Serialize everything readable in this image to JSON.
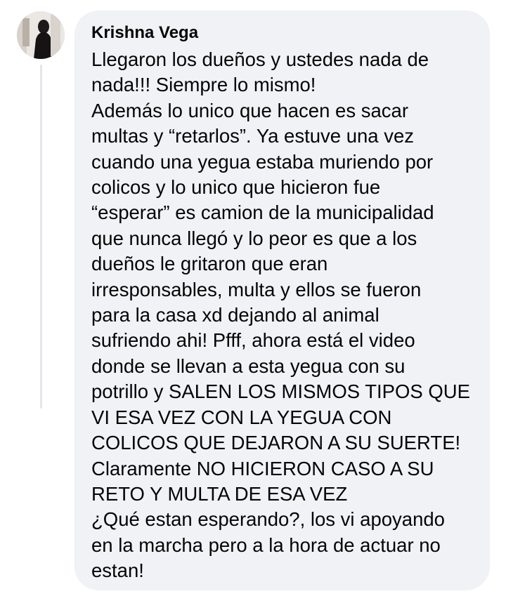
{
  "comment": {
    "author": "Krishna Vega",
    "lines": [
      "Llegaron los dueños y ustedes nada de",
      "nada!!! Siempre lo mismo!",
      "Además lo unico que hacen es sacar",
      "multas y “retarlos”. Ya estuve una vez",
      "cuando una yegua estaba muriendo por",
      "colicos y lo unico que hicieron fue",
      "“esperar” es camion de la municipalidad",
      "que nunca llegó y lo peor es que a los",
      "dueños le gritaron que eran",
      "irresponsables, multa y ellos se fueron",
      "para la casa xd dejando al animal",
      "sufriendo ahi! Pfff, ahora está el video",
      "donde se llevan a esta yegua con su",
      "potrillo y SALEN LOS MISMOS TIPOS QUE",
      "VI ESA VEZ CON LA YEGUA CON",
      "COLICOS QUE DEJARON A SU SUERTE!",
      "Claramente NO HICIERON CASO A SU",
      "RETO Y MULTA DE ESA VEZ",
      "¿Qué estan esperando?, los vi apoyando",
      "en la marcha pero a la hora de actuar no",
      "estan!"
    ]
  },
  "colors": {
    "bubble_background": "#f0f2f5",
    "text": "#050505",
    "thread_line": "#e4e6eb"
  }
}
